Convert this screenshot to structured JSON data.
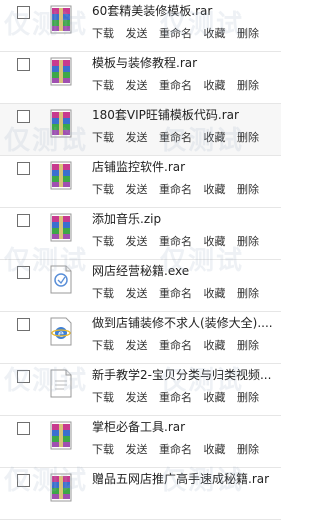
{
  "actions": {
    "download": "下载",
    "send": "发送",
    "rename": "重命名",
    "favorite": "收藏",
    "delete": "删除"
  },
  "files": [
    {
      "name": "60套精美装修模板.rar",
      "icon": "rar-archive-icon"
    },
    {
      "name": "模板与装修教程.rar",
      "icon": "rar-archive-icon"
    },
    {
      "name": "180套VIP旺铺模板代码.rar",
      "icon": "rar-archive-icon"
    },
    {
      "name": "店铺监控软件.rar",
      "icon": "rar-archive-icon"
    },
    {
      "name": "添加音乐.zip",
      "icon": "zip-archive-icon"
    },
    {
      "name": "网店经营秘籍.exe",
      "icon": "exe-file-icon"
    },
    {
      "name": "做到店铺装修不求人(装修大全)....",
      "icon": "ie-file-icon"
    },
    {
      "name": "新手教学2-宝贝分类与归类视频...",
      "icon": "generic-file-icon"
    },
    {
      "name": "掌柜必备工具.rar",
      "icon": "rar-archive-icon"
    },
    {
      "name": "赠品五网店推广高手速成秘籍.rar",
      "icon": "rar-archive-icon"
    }
  ],
  "watermark_text": "仅测试"
}
